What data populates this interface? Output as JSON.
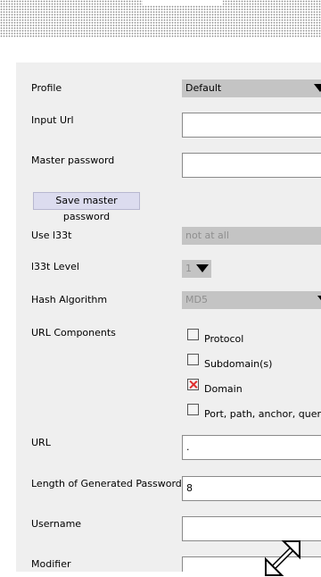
{
  "form": {
    "profile": {
      "label": "Profile",
      "value": "Default"
    },
    "input_url": {
      "label": "Input Url",
      "value": ""
    },
    "master_password": {
      "label": "Master password",
      "value": ""
    },
    "save_master_button": "Save master password",
    "use_l33t": {
      "label": "Use l33t",
      "value": "not at all"
    },
    "l33t_level": {
      "label": "l33t Level",
      "value": "1"
    },
    "hash_algorithm": {
      "label": "Hash Algorithm",
      "value": "MD5"
    },
    "url_components": {
      "label": "URL Components",
      "options": [
        {
          "label": "Protocol",
          "checked": false
        },
        {
          "label": "Subdomain(s)",
          "checked": false
        },
        {
          "label": "Domain",
          "checked": true
        },
        {
          "label": "Port, path, anchor, query pa",
          "checked": false
        }
      ]
    },
    "url": {
      "label": "URL",
      "value": "."
    },
    "password_length": {
      "label": "Length of Generated Password",
      "value": "8"
    },
    "username": {
      "label": "Username",
      "value": ""
    },
    "modifier": {
      "label": "Modifier",
      "value": ""
    }
  },
  "icons": {
    "resize": "expand-arrows-icon"
  }
}
